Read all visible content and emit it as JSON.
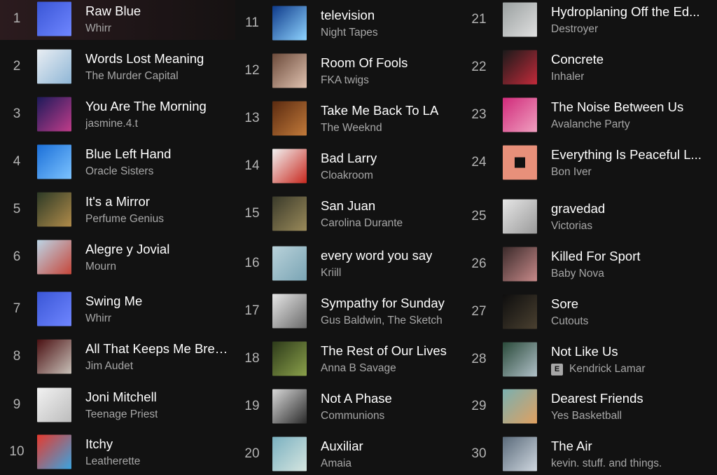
{
  "tracks": [
    {
      "n": "1",
      "title": "Raw Blue",
      "artist": "Whirr",
      "art": [
        "#3a56d6",
        "#6f86ff"
      ]
    },
    {
      "n": "2",
      "title": "Words Lost Meaning",
      "artist": "The Murder Capital",
      "art": [
        "#e9eef3",
        "#8fb6d6"
      ]
    },
    {
      "n": "3",
      "title": "You Are The Morning",
      "artist": "jasmine.4.t",
      "art": [
        "#1d1a5a",
        "#c03c8a"
      ]
    },
    {
      "n": "4",
      "title": "Blue Left Hand",
      "artist": "Oracle Sisters",
      "art": [
        "#1b6fd8",
        "#7cc3ff"
      ]
    },
    {
      "n": "5",
      "title": "It's a Mirror",
      "artist": "Perfume Genius",
      "art": [
        "#2d3a26",
        "#b08b4a"
      ]
    },
    {
      "n": "6",
      "title": "Alegre y Jovial",
      "artist": "Mourn",
      "art": [
        "#bcd5e6",
        "#c6463a"
      ]
    },
    {
      "n": "7",
      "title": "Swing Me",
      "artist": "Whirr",
      "art": [
        "#3a56d6",
        "#6f86ff"
      ]
    },
    {
      "n": "8",
      "title": "All That Keeps Me Breat...",
      "artist": "Jim Audet",
      "art": [
        "#4a1012",
        "#c8c0b8"
      ]
    },
    {
      "n": "9",
      "title": "Joni Mitchell",
      "artist": "Teenage Priest",
      "art": [
        "#f2f2f2",
        "#bcbcbc"
      ]
    },
    {
      "n": "10",
      "title": "Itchy",
      "artist": "Leatherette",
      "art": [
        "#e63a2e",
        "#3aa4e0"
      ]
    },
    {
      "n": "11",
      "title": "television",
      "artist": "Night Tapes",
      "art": [
        "#0e3a8a",
        "#8fd4ff"
      ]
    },
    {
      "n": "12",
      "title": "Room Of Fools",
      "artist": "FKA twigs",
      "art": [
        "#6b4a3a",
        "#e0c2b0"
      ]
    },
    {
      "n": "13",
      "title": "Take Me Back To LA",
      "artist": "The Weeknd",
      "art": [
        "#5a2a10",
        "#c27a3a"
      ]
    },
    {
      "n": "14",
      "title": "Bad Larry",
      "artist": "Cloakroom",
      "art": [
        "#f2f2f2",
        "#c8281e"
      ]
    },
    {
      "n": "15",
      "title": "San Juan",
      "artist": "Carolina Durante",
      "art": [
        "#3a3a2a",
        "#9a8a5a"
      ]
    },
    {
      "n": "16",
      "title": "every word you say",
      "artist": "Kriill",
      "art": [
        "#b9d2da",
        "#7aa4b4"
      ]
    },
    {
      "n": "17",
      "title": "Sympathy for Sunday",
      "artist": "Gus Baldwin, The Sketch",
      "art": [
        "#e6e6e6",
        "#6a6a6a"
      ]
    },
    {
      "n": "18",
      "title": "The Rest of Our Lives",
      "artist": "Anna B Savage",
      "art": [
        "#2d3a1a",
        "#8aa04a"
      ]
    },
    {
      "n": "19",
      "title": "Not A Phase",
      "artist": "Communions",
      "art": [
        "#d8d8d8",
        "#2a2a2a"
      ]
    },
    {
      "n": "20",
      "title": "Auxiliar",
      "artist": "Amaia",
      "art": [
        "#7ab0c0",
        "#d6e6e0"
      ]
    },
    {
      "n": "21",
      "title": "Hydroplaning Off the Ed...",
      "artist": "Destroyer",
      "art": [
        "#9aa0a0",
        "#e0e0e0"
      ]
    },
    {
      "n": "22",
      "title": "Concrete",
      "artist": "Inhaler",
      "art": [
        "#1a1a1a",
        "#c22a3a"
      ]
    },
    {
      "n": "23",
      "title": "The Noise Between Us",
      "artist": "Avalanche Party",
      "art": [
        "#d02a7a",
        "#f0a0c0"
      ]
    },
    {
      "n": "24",
      "title": "Everything Is Peaceful L...",
      "artist": "Bon Iver",
      "art": [
        "#e8907a",
        "#e8907a"
      ]
    },
    {
      "n": "25",
      "title": "gravedad",
      "artist": "Victorias",
      "art": [
        "#e6e6e6",
        "#9a9a9a"
      ]
    },
    {
      "n": "26",
      "title": "Killed For Sport",
      "artist": "Baby Nova",
      "art": [
        "#3a2a2a",
        "#c88a8a"
      ]
    },
    {
      "n": "27",
      "title": "Sore",
      "artist": "Cutouts",
      "art": [
        "#0e0e0e",
        "#4a4030"
      ]
    },
    {
      "n": "28",
      "title": "Not Like Us",
      "artist": "Kendrick Lamar",
      "explicit": "E",
      "art": [
        "#2a4a3a",
        "#b0c0c8"
      ]
    },
    {
      "n": "29",
      "title": "Dearest Friends",
      "artist": "Yes Basketball",
      "art": [
        "#7ab0b0",
        "#e0a060"
      ]
    },
    {
      "n": "30",
      "title": "The Air",
      "artist": "kevin. stuff. and things.",
      "art": [
        "#5a6a7a",
        "#d0d8e0"
      ]
    }
  ]
}
